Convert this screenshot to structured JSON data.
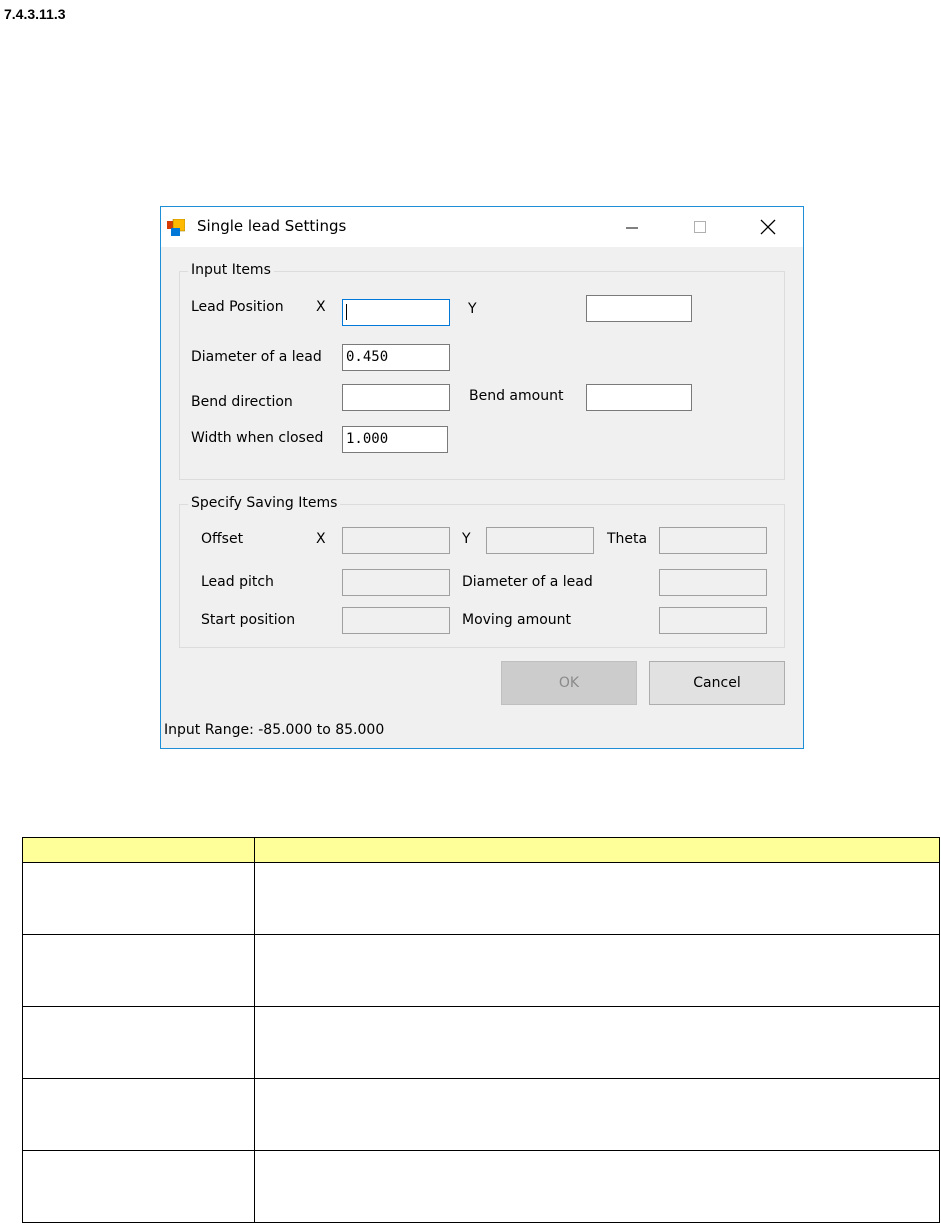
{
  "section": {
    "number": "7.4.3.11.3"
  },
  "window": {
    "title": "Single lead Settings",
    "input_items": {
      "legend": "Input Items",
      "lead_position_label": "Lead Position",
      "x_label": "X",
      "y_label": "Y",
      "lead_x_value": "",
      "lead_y_value": "",
      "diameter_label": "Diameter of a lead",
      "diameter_value": "0.450",
      "bend_direction_label": "Bend direction",
      "bend_direction_value": "",
      "bend_amount_label": "Bend amount",
      "bend_amount_value": "",
      "width_closed_label": "Width when closed",
      "width_closed_value": "1.000"
    },
    "saving_items": {
      "legend": "Specify Saving Items",
      "offset_label": "Offset",
      "x_label": "X",
      "y_label": "Y",
      "theta_label": "Theta",
      "lead_pitch_label": "Lead pitch",
      "diameter_label": "Diameter of a lead",
      "start_position_label": "Start position",
      "moving_amount_label": "Moving amount"
    },
    "ok_label": "OK",
    "cancel_label": "Cancel",
    "status_text": "Input Range: -85.000 to 85.000"
  },
  "colors": {
    "header_fill": "#ffff99",
    "window_border": "#1e8fd6",
    "focus_border": "#0078d7"
  }
}
